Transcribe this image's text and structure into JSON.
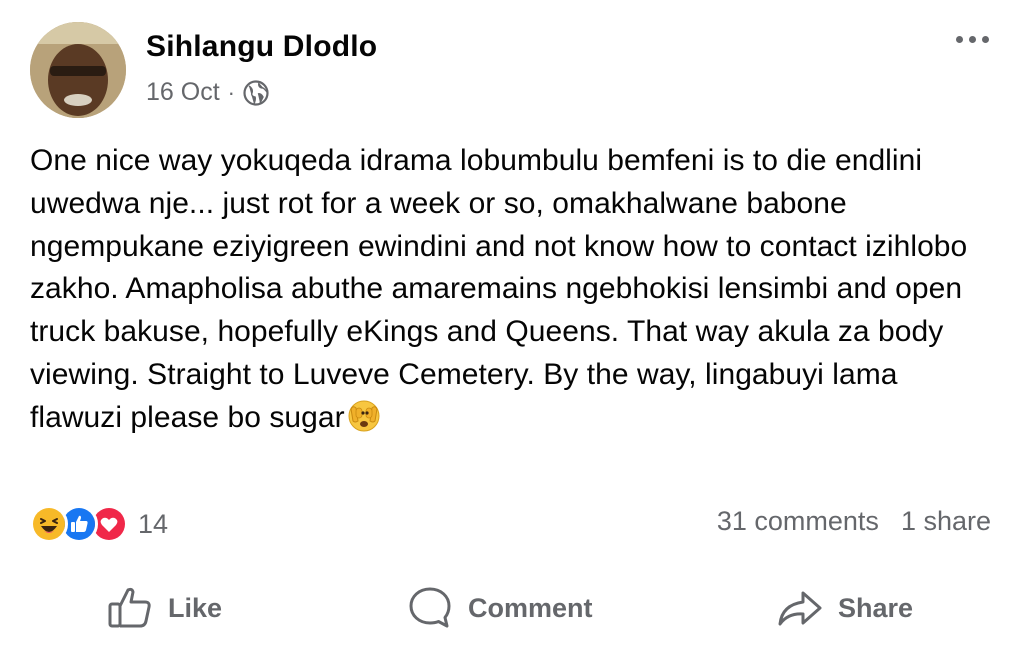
{
  "post": {
    "author": "Sihlangu Dlodlo",
    "date": "16 Oct",
    "separator": "·",
    "audience_icon": "globe-icon",
    "more_icon": "more-options-icon",
    "text": "One nice way yokuqeda idrama lobumbulu bemfeni is to die endlini uwedwa nje... just rot for a week or so, omakhalwane babone ngempukane eziyigreen ewindini and not know how to contact izihlobo zakho. Amapholisa abuthe amaremains ngebhokisi lensimbi and open truck bakuse, hopefully eKings and Queens. That way akula za body viewing. Straight to Luveve Cemetery. By the way, lingabuyi lama flawuzi please bo sugar",
    "text_emoji": "see-no-evil-face-emoji"
  },
  "reactions": {
    "icons": [
      "haha-icon",
      "like-icon",
      "love-icon"
    ],
    "count": "14",
    "colors": {
      "like": "#1877f2",
      "love": "#f02849",
      "haha": "#f7b928"
    }
  },
  "stats": {
    "comments": "31 comments",
    "shares": "1 share"
  },
  "actions": {
    "like_label": "Like",
    "comment_label": "Comment",
    "share_label": "Share"
  },
  "colors": {
    "text": "#050505",
    "secondary": "#65676b"
  }
}
